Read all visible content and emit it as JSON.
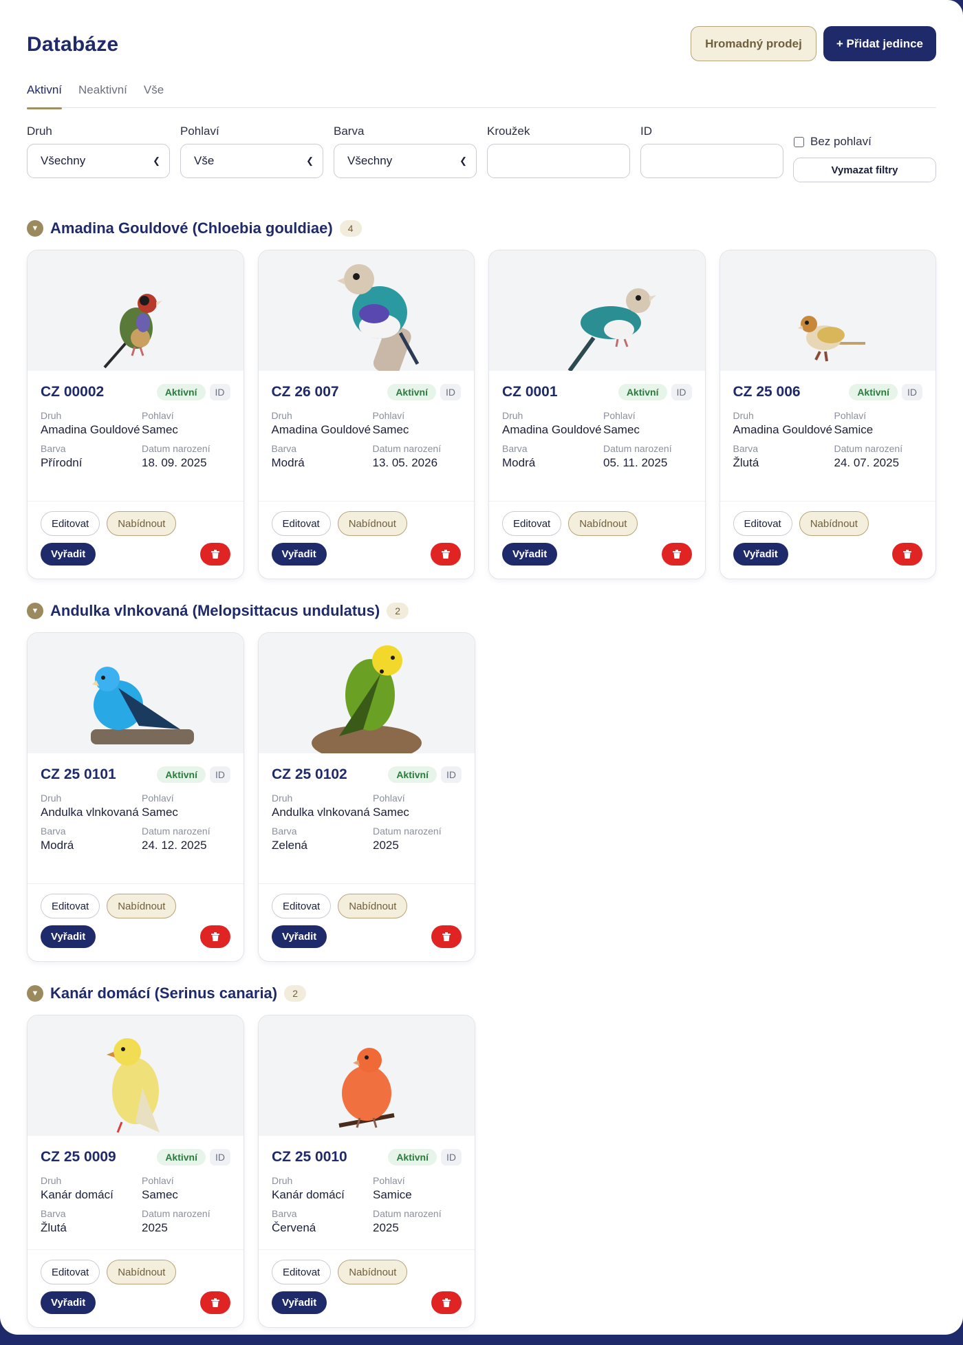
{
  "header": {
    "title": "Databáze",
    "bulk_sale_label": "Hromadný prodej",
    "add_label": "+ Přidat jedince"
  },
  "tabs": [
    {
      "label": "Aktivní",
      "active": true
    },
    {
      "label": "Neaktivní",
      "active": false
    },
    {
      "label": "Vše",
      "active": false
    }
  ],
  "filters": {
    "species": {
      "label": "Druh",
      "value": "Všechny"
    },
    "sex": {
      "label": "Pohlaví",
      "value": "Vše"
    },
    "color": {
      "label": "Barva",
      "value": "Všechny"
    },
    "ring": {
      "label": "Kroužek",
      "value": ""
    },
    "id": {
      "label": "ID",
      "value": ""
    },
    "no_sex_label": "Bez pohlaví",
    "no_sex_checked": false,
    "clear_label": "Vymazat filtry"
  },
  "labels": {
    "species": "Druh",
    "sex": "Pohlaví",
    "color": "Barva",
    "born": "Datum narození",
    "edit": "Editovat",
    "offer": "Nabídnout",
    "retire": "Vyřadit",
    "id_badge": "ID",
    "delete_icon": "trash-icon",
    "toggle_icon": "triangle-down-icon"
  },
  "colors": {
    "brand": "#1f2a6b",
    "accent": "#9b8a5e",
    "status_active": "#2c7a3c",
    "danger": "#e02424"
  },
  "groups": [
    {
      "title": "Amadina Gouldové (Chloebia gouldiae)",
      "count": "4",
      "birds": [
        {
          "ring": "CZ 00002",
          "status": "Aktivní",
          "species": "Amadina Gouldové",
          "sex": "Samec",
          "color": "Přírodní",
          "born": "18. 09. 2025"
        },
        {
          "ring": "CZ 26 007",
          "status": "Aktivní",
          "species": "Amadina Gouldové",
          "sex": "Samec",
          "color": "Modrá",
          "born": "13. 05. 2026"
        },
        {
          "ring": "CZ 0001",
          "status": "Aktivní",
          "species": "Amadina Gouldové",
          "sex": "Samec",
          "color": "Modrá",
          "born": "05. 11. 2025"
        },
        {
          "ring": "CZ 25 006",
          "status": "Aktivní",
          "species": "Amadina Gouldové",
          "sex": "Samice",
          "color": "Žlutá",
          "born": "24. 07. 2025"
        }
      ]
    },
    {
      "title": "Andulka vlnkovaná (Melopsittacus undulatus)",
      "count": "2",
      "birds": [
        {
          "ring": "CZ 25 0101",
          "status": "Aktivní",
          "species": "Andulka vlnkovaná",
          "sex": "Samec",
          "color": "Modrá",
          "born": "24. 12. 2025"
        },
        {
          "ring": "CZ 25 0102",
          "status": "Aktivní",
          "species": "Andulka vlnkovaná",
          "sex": "Samec",
          "color": "Zelená",
          "born": "2025"
        }
      ]
    },
    {
      "title": "Kanár domácí (Serinus canaria)",
      "count": "2",
      "birds": [
        {
          "ring": "CZ 25 0009",
          "status": "Aktivní",
          "species": "Kanár domácí",
          "sex": "Samec",
          "color": "Žlutá",
          "born": "2025"
        },
        {
          "ring": "CZ 25 0010",
          "status": "Aktivní",
          "species": "Kanár domácí",
          "sex": "Samice",
          "color": "Červená",
          "born": "2025"
        }
      ]
    }
  ]
}
